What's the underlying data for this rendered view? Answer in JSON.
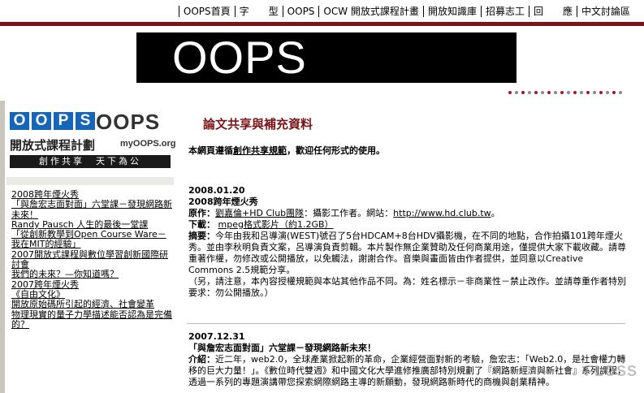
{
  "nav": {
    "items": [
      "OOPS首頁",
      "字　　型",
      "OOPS",
      "OCW 開放式課程計畫",
      "開放知識庫",
      "招募志工",
      "回　　應",
      "中文討論區"
    ]
  },
  "banner": {
    "title": "OOPS"
  },
  "logo": {
    "blue_text": [
      "O",
      "O",
      "P",
      "S"
    ],
    "brand": "OOPS",
    "subtitle": "開放式課程計劃",
    "url": "myOOPS.org",
    "slogan": "創作共享　天下為公"
  },
  "sidebar": {
    "links": [
      "2008跨年煙火秀",
      "「與詹宏志面對面」六堂課－發現網路新未來！",
      "Randy Pausch 人生的最後一堂課",
      "「從創新教學到Open Course Ware－我在MIT的經驗」",
      "2007開放式課程與數位學習創新國際研討會",
      "我們的未來？—你知道嗎？",
      "2007跨年煙火秀",
      "《自由文化》",
      "開放原始碼所引起的經濟、社會變革",
      "物理現實的量子力學描述能否認為是完備的？"
    ]
  },
  "main": {
    "title": "論文共享與補充資料",
    "intro_pre": "本網頁遵循",
    "intro_link": "創作共享規範",
    "intro_post": "，歡迎任何形式的使用。",
    "entries": [
      {
        "date": "2008.01.20",
        "title": "2008跨年煙火秀",
        "original_label": "原作：",
        "original_link": "劉嘉倫+HD Club團隊",
        "original_text": "：攝影工作者。網站：",
        "original_site": "http://www.hd.club.tw",
        "original_end": "。",
        "download_label": "下載：",
        "download_link": "mpeg格式影片（約1.2GB）",
        "summary_label": "摘要：",
        "summary": "今年由我和呂導演(WEST)號召了5台HDCAM+8台HDV攝影機，在不同的地點，合作拍攝101跨年煙火秀。並由李秋明負責文案，呂導演負責剪輯。本片製作無企業贊助及任何商業用途，僅提供大家下載收藏。請尊重著作權，勿修改或公開播放，以免觸法，謝謝合作。音樂與畫面皆由作者提供，並同意以Creative Commons 2.5規範分享。",
        "note": "（另，請注意，本內容授權規範與本站其他作品不同。為：姓名標示－非商業性－禁止改作。並請尊重作者特別要求：勿公開播放。）"
      },
      {
        "date": "2007.12.31",
        "title": "「與詹宏志面對面」六堂課－發現網路新未來！",
        "intro_label": "介紹：",
        "intro": "近二年，web2.0，全球產業掀起新的革命，企業經營面對新的考驗，詹宏志：「Web2.0，是社會權力轉移的巨大力量！」。《數位時代雙週》和中國文化大學進修推廣部特別規劃了『網路新經濟與新社會』系列課程，透過一系列的專題演講帶您探索網際網路主導的新願動，發現網路新時代的商機與創業精神。"
      }
    ]
  },
  "watermark": "FLOSS"
}
